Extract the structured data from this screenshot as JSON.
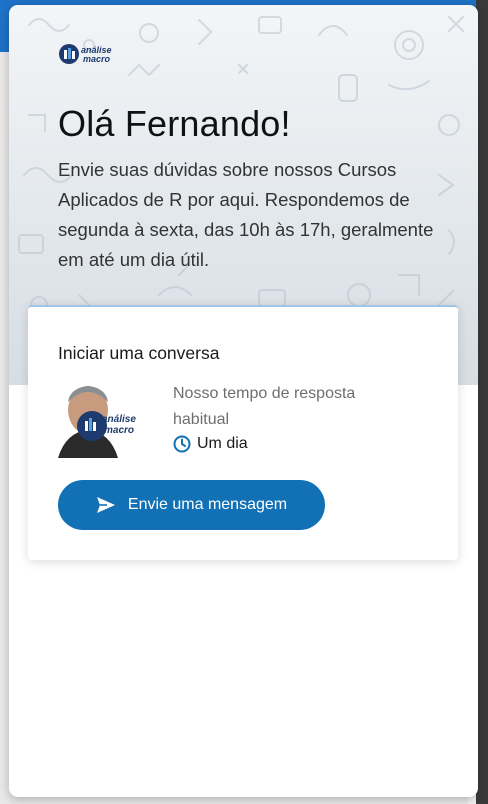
{
  "colors": {
    "accent": "#1270b5",
    "page_top_bar": "#1f72c9",
    "header_bg": "#e3e8ec"
  },
  "brand": {
    "logo_line1": "análise",
    "logo_line2": "macro"
  },
  "header": {
    "greeting": "Olá Fernando!",
    "intro": "Envie suas dúvidas sobre nossos Cursos Aplicados de R por aqui. Respondemos de segunda à sexta, das 10h às 17h, geralmente em até um dia útil."
  },
  "card": {
    "title": "Iniciar uma conversa",
    "response_label": "Nosso tempo de resposta habitual",
    "response_time": "Um dia",
    "send_button_label": "Envie uma mensagem",
    "icons": {
      "clock": "clock-icon",
      "send": "paper-plane-icon"
    }
  }
}
